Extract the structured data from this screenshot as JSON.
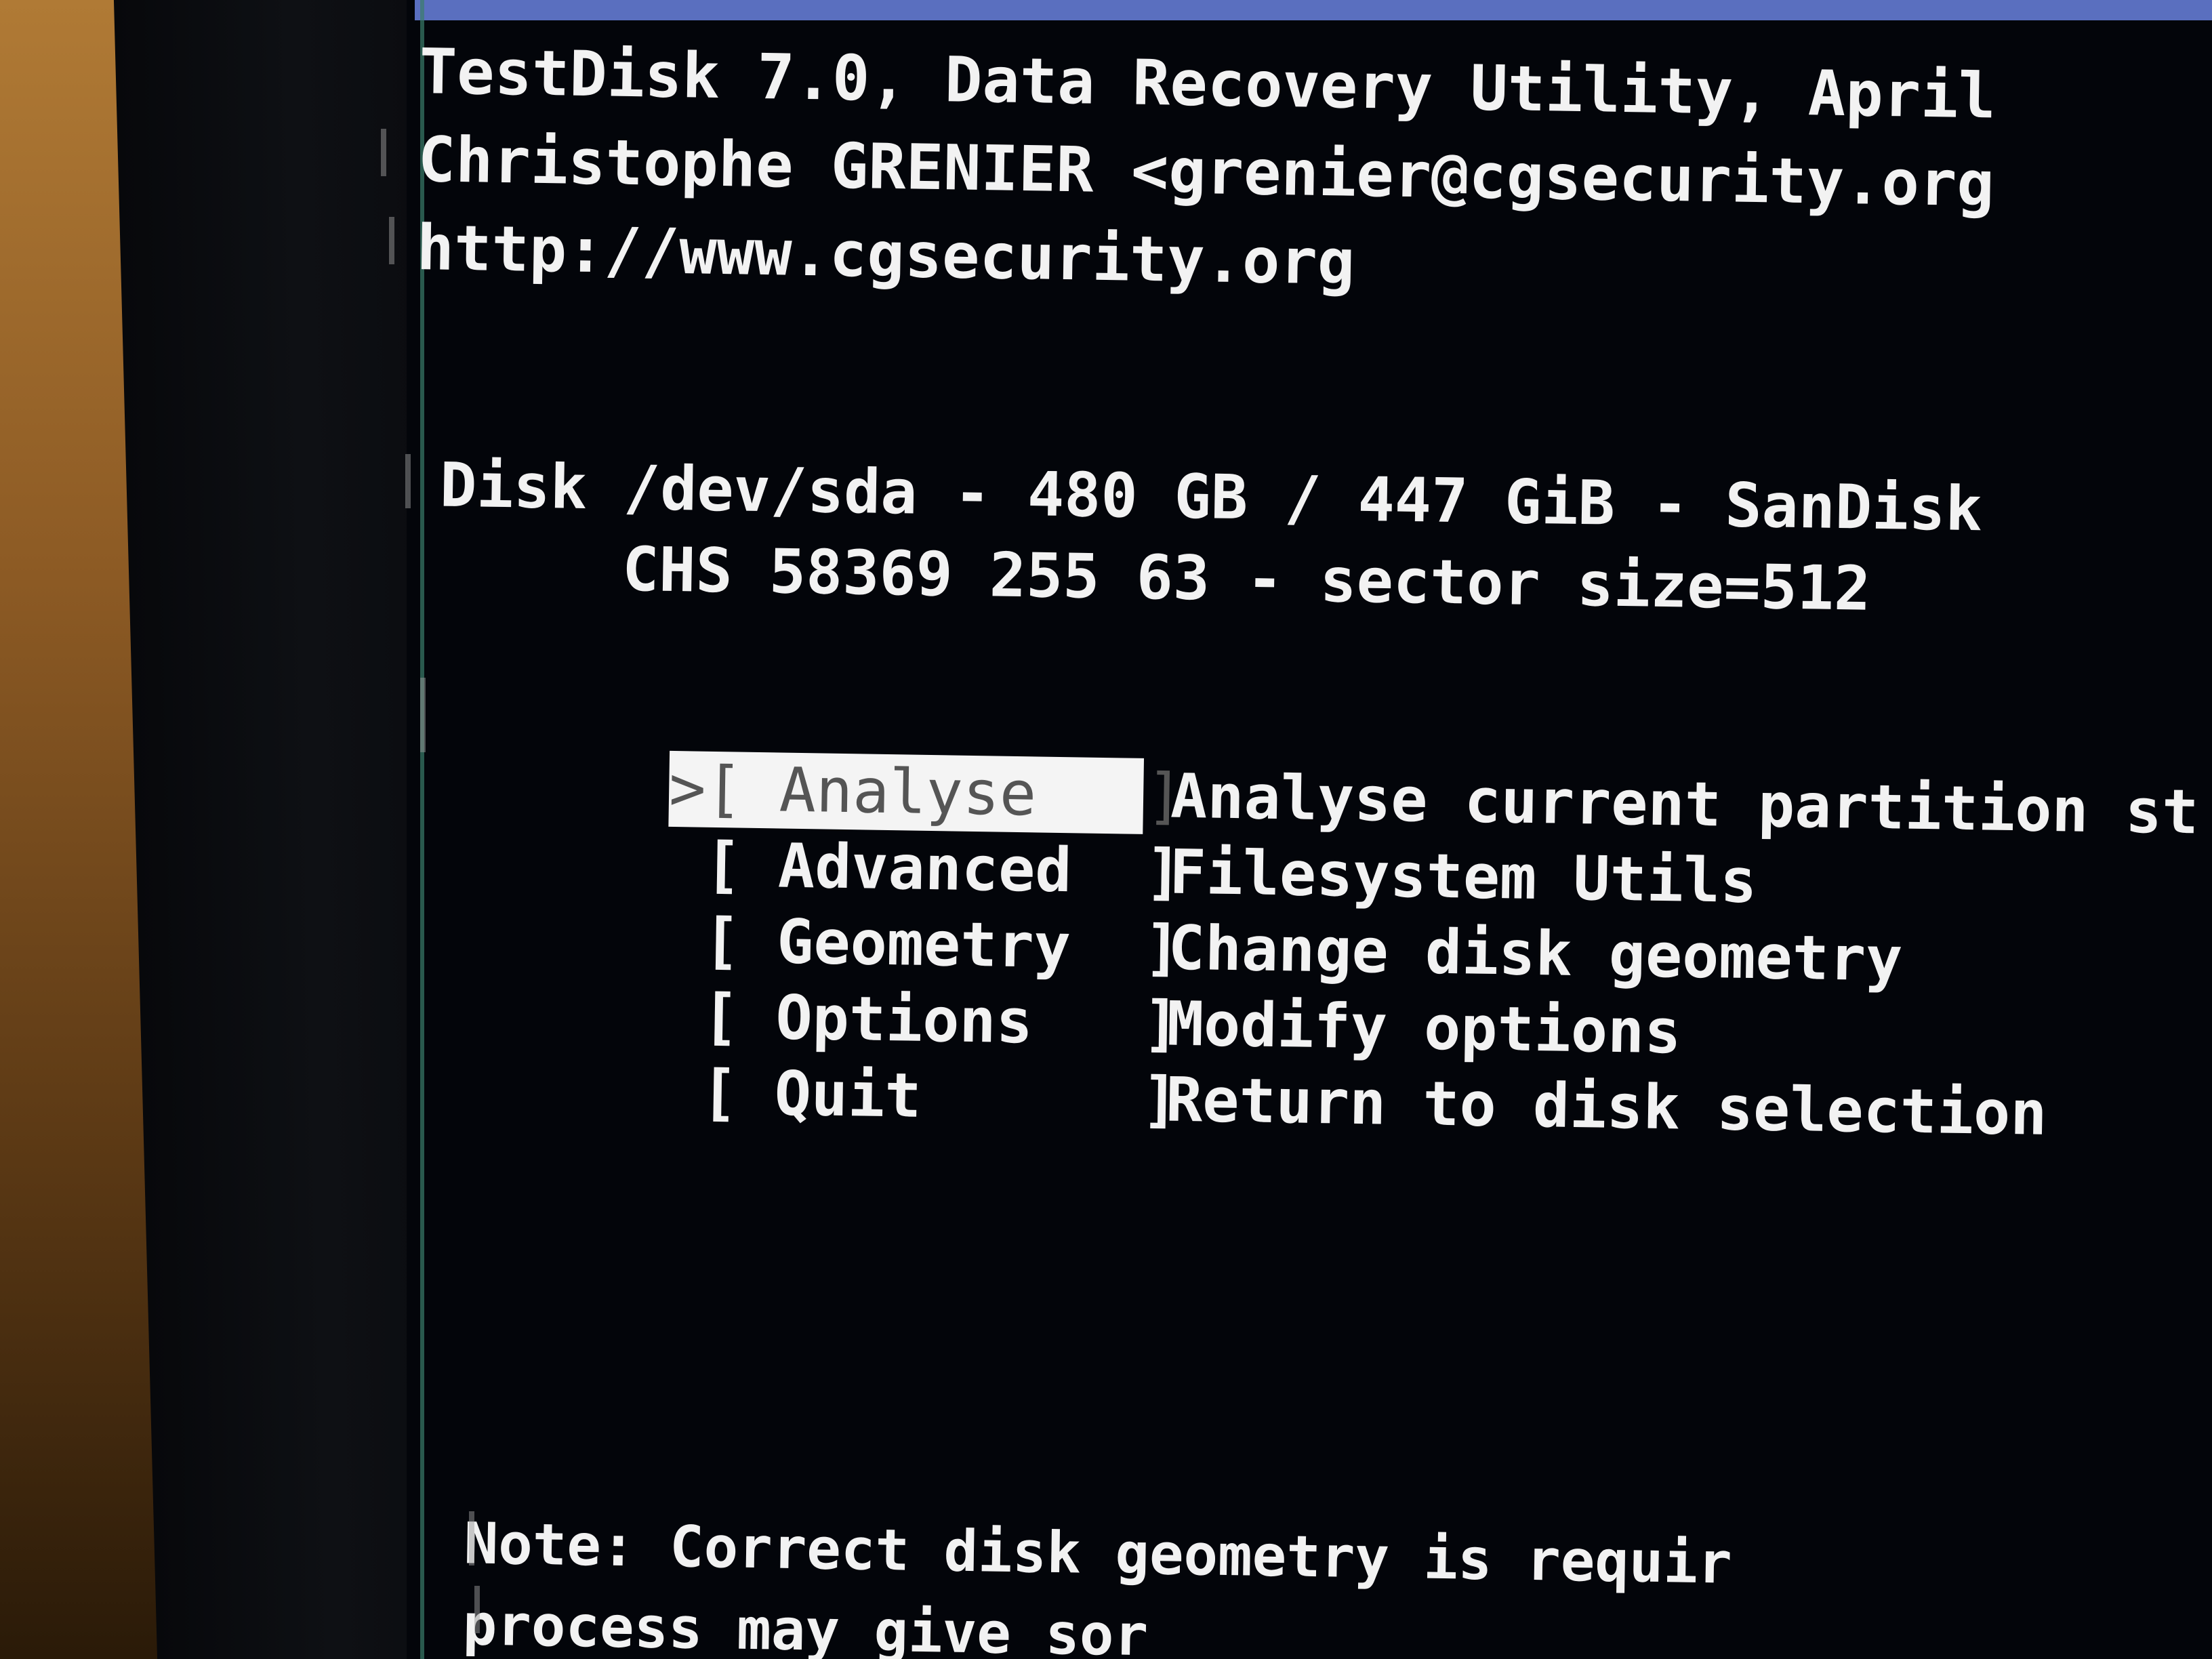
{
  "header": {
    "line1": "TestDisk 7.0, Data Recovery Utility, April",
    "line2": "Christophe GRENIER <grenier@cgsecurity.org",
    "line3": "http://www.cgsecurity.org"
  },
  "disk": {
    "line1": "Disk /dev/sda - 480 GB / 447 GiB - SanDisk",
    "line2": "     CHS 58369 255 63 - sector size=512"
  },
  "menu": {
    "items": [
      {
        "label": ">[ Analyse   ]",
        "desc": "Analyse current partition str",
        "selected": true
      },
      {
        "label": " [ Advanced  ]",
        "desc": "Filesystem Utils",
        "selected": false
      },
      {
        "label": " [ Geometry  ]",
        "desc": "Change disk geometry",
        "selected": false
      },
      {
        "label": " [ Options   ]",
        "desc": "Modify options",
        "selected": false
      },
      {
        "label": " [ Quit      ]",
        "desc": "Return to disk selection",
        "selected": false
      }
    ]
  },
  "note": {
    "line1": "Note: Correct disk geometry is requir",
    "line2": "process may give sor"
  },
  "colors": {
    "terminal_bg": "#03050a",
    "text": "#f2f2f2",
    "selection_bg": "#f4f4f4",
    "title_bar": "#5a6fbf"
  }
}
